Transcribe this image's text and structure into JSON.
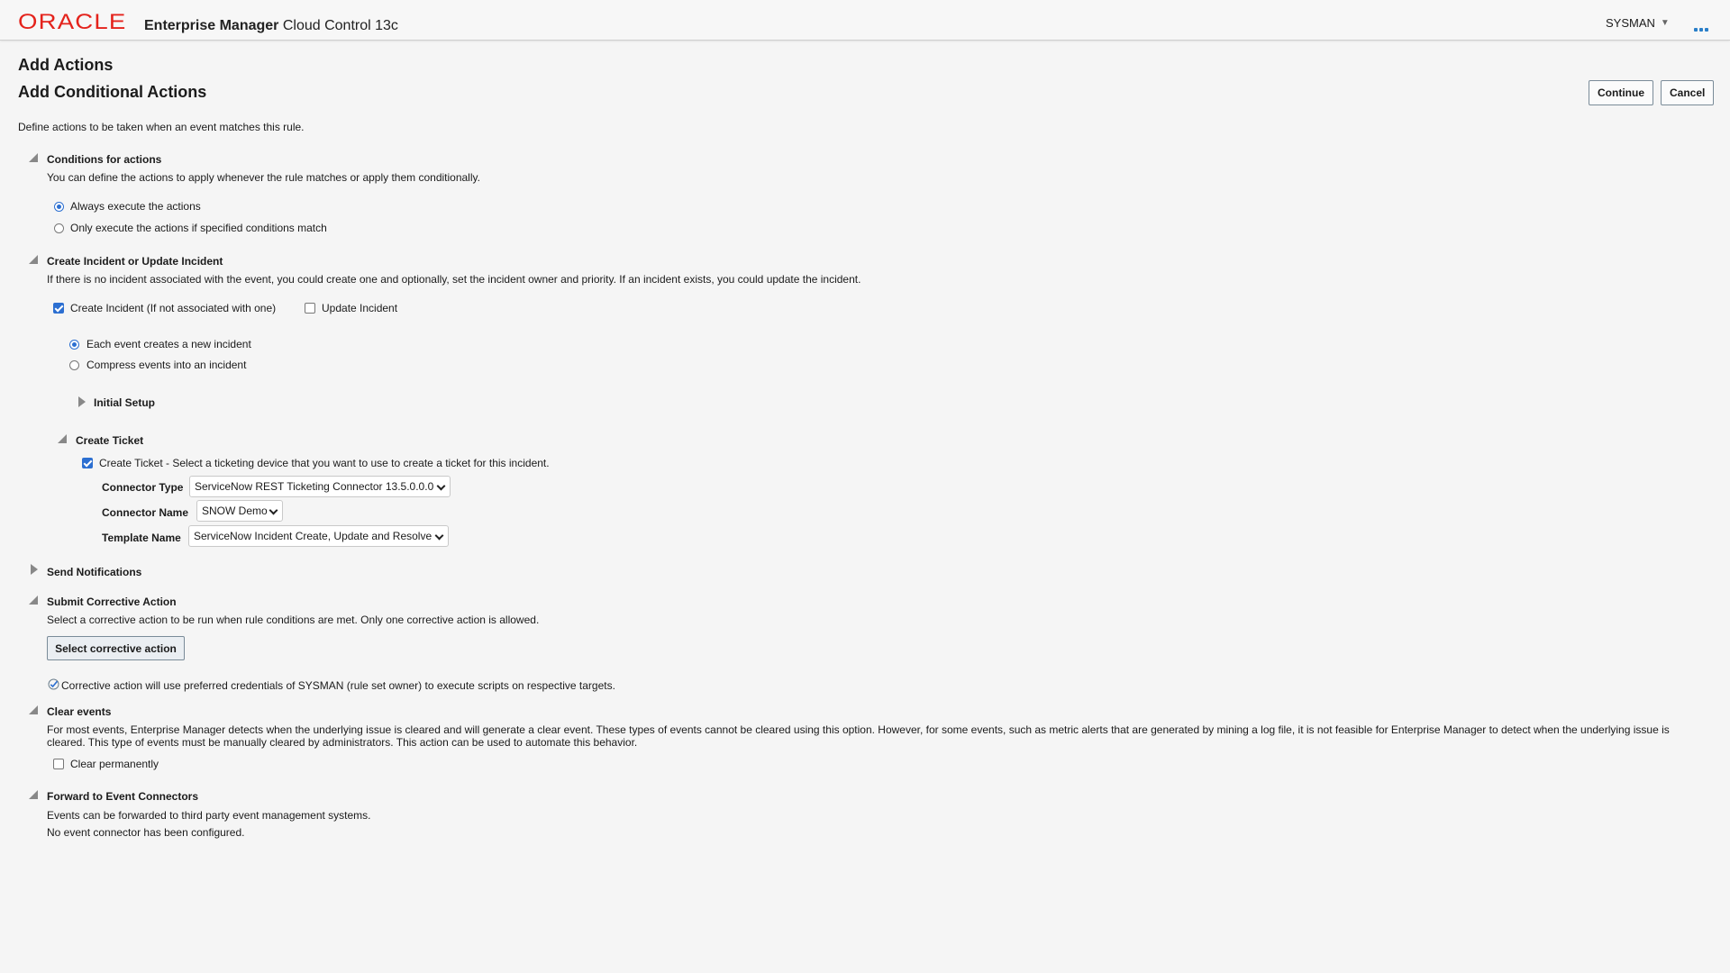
{
  "header": {
    "logo": "ORACLE",
    "app_title_bold": "Enterprise Manager",
    "app_title_sub": "Cloud Control 13c",
    "user": "SYSMAN"
  },
  "page": {
    "title": "Add Actions",
    "subtitle": "Add Conditional Actions",
    "description": "Define actions to be taken when an event matches this rule.",
    "continue_label": "Continue",
    "cancel_label": "Cancel"
  },
  "conditions": {
    "heading": "Conditions for actions",
    "description": "You can define the actions to apply whenever the rule matches or apply them conditionally.",
    "options": [
      {
        "label": "Always execute the actions",
        "selected": true
      },
      {
        "label": "Only execute the actions if specified conditions match",
        "selected": false
      }
    ]
  },
  "incident": {
    "heading": "Create Incident or Update Incident",
    "description": "If there is no incident associated with the event, you could create one and optionally, set the incident owner and priority. If an incident exists, you could update the incident.",
    "create_label": "Create Incident (If not associated with one)",
    "create_checked": true,
    "update_label": "Update Incident",
    "update_checked": false,
    "modes": [
      {
        "label": "Each event creates a new incident",
        "selected": true
      },
      {
        "label": "Compress events into an incident",
        "selected": false
      }
    ],
    "initial_setup": "Initial Setup",
    "create_ticket": {
      "heading": "Create Ticket",
      "checkbox_label": "Create Ticket - Select a ticketing device that you want to use to create a ticket for this incident.",
      "checked": true,
      "connector_type_label": "Connector Type",
      "connector_type_value": "ServiceNow REST Ticketing Connector 13.5.0.0.0",
      "connector_name_label": "Connector Name",
      "connector_name_value": "SNOW Demo",
      "template_name_label": "Template Name",
      "template_name_value": "ServiceNow Incident Create, Update and Resolve"
    }
  },
  "notifications": {
    "heading": "Send Notifications"
  },
  "corrective": {
    "heading": "Submit Corrective Action",
    "description": "Select a corrective action to be run when rule conditions are met. Only one corrective action is allowed.",
    "button_label": "Select corrective action",
    "info": "Corrective action will use preferred credentials of SYSMAN (rule set owner) to execute scripts on respective targets."
  },
  "clear_events": {
    "heading": "Clear events",
    "description_line1": "For most events, Enterprise Manager detects when the underlying issue is cleared and will generate a clear event. These types of events cannot be cleared using this option. However, for some events, such as metric alerts that are generated by mining a log file, it is not feasible for Enterprise Manager to detect when the underlying issue is",
    "description_line2": "cleared. This type of events must be manually cleared by administrators. This action can be used to automate this behavior.",
    "checkbox_label": "Clear permanently",
    "checked": false
  },
  "forward": {
    "heading": "Forward to Event Connectors",
    "description": "Events can be forwarded to third party event management systems.",
    "status": "No event connector has been configured."
  },
  "colors": {
    "brand_red": "#e4231c",
    "accent_blue": "#2c6fd1",
    "background": "#f5f5f5"
  }
}
